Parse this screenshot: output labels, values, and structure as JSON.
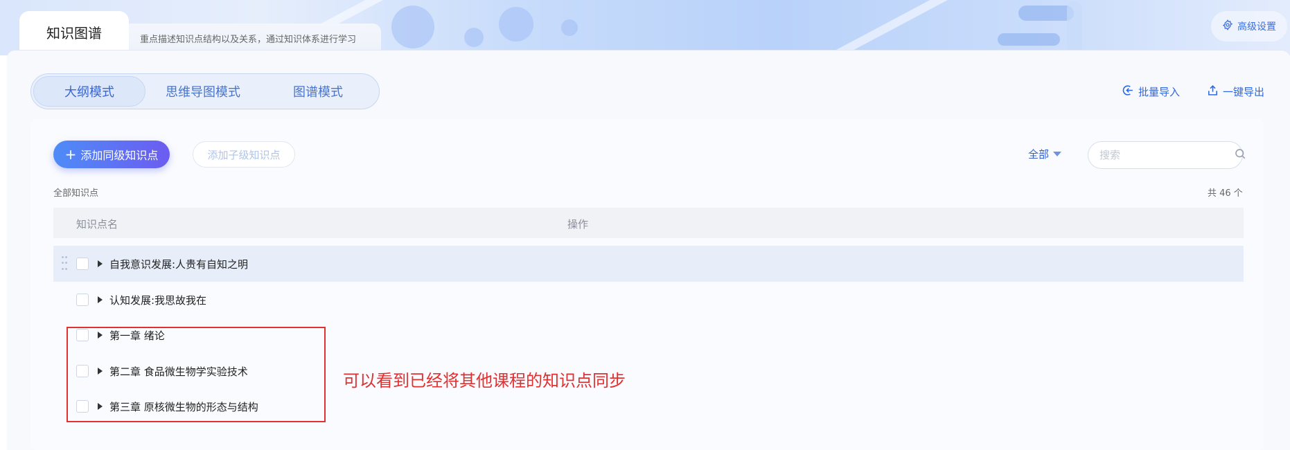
{
  "tabs": {
    "active_label": "知识图谱",
    "description": "重点描述知识点结构以及关系，通过知识体系进行学习"
  },
  "header": {
    "advanced_settings": "高级设置"
  },
  "modes": [
    "大纲模式",
    "思维导图模式",
    "图谱模式"
  ],
  "actions": {
    "batch_import": "批量导入",
    "one_click_export": "一键导出",
    "add_sibling": "添加同级知识点",
    "add_child": "添加子级知识点"
  },
  "filter": {
    "selected": "全部"
  },
  "search": {
    "placeholder": "搜索"
  },
  "list": {
    "section_label": "全部知识点",
    "total": "共 46 个",
    "columns": [
      "知识点名",
      "操作"
    ],
    "rows": [
      "自我意识发展:人贵有自知之明",
      "认知发展:我思故我在",
      "第一章 绪论",
      "第二章 食品微生物学实验技术",
      "第三章 原核微生物的形态与结构"
    ]
  },
  "annotation": {
    "note": "可以看到已经将其他课程的知识点同步"
  }
}
